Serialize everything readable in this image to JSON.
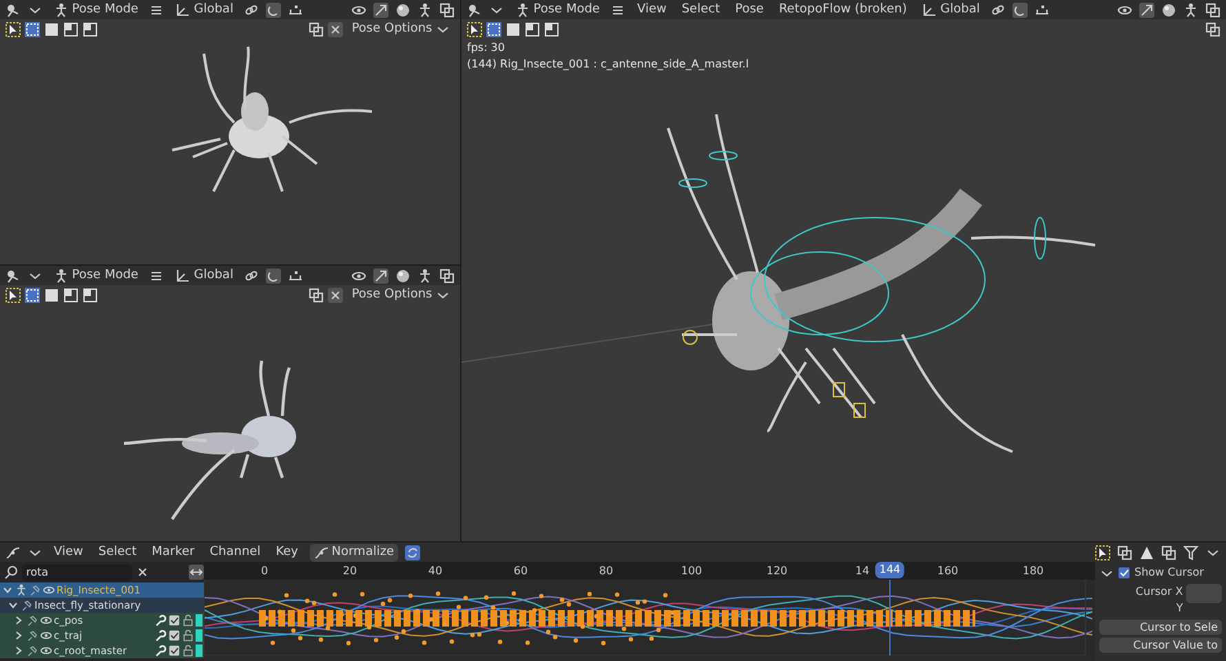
{
  "viewports": [
    {
      "header": {
        "mode": "Pose Mode",
        "orientation": "Global",
        "options": "Pose Options"
      }
    },
    {
      "header": {
        "mode": "Pose Mode",
        "orientation": "Global",
        "options": "Pose Options"
      }
    },
    {
      "header": {
        "mode": "Pose Mode",
        "menus": [
          "View",
          "Select",
          "Pose",
          "RetopoFlow (broken)"
        ],
        "orientation": "Global"
      },
      "overlay_text": [
        "fps: 30",
        "(144) Rig_Insecte_001 : c_antenne_side_A_master.l"
      ]
    }
  ],
  "graph_editor": {
    "menus": [
      "View",
      "Select",
      "Marker",
      "Channel",
      "Key"
    ],
    "normalize": {
      "label": "Normalize",
      "on": false
    },
    "search": {
      "value": "rota"
    },
    "channels": [
      {
        "kind": "object",
        "name": "Rig_Insecte_001",
        "selected": true,
        "expanded": true,
        "children": [
          {
            "kind": "action",
            "name": "Insect_fly_stationary",
            "selected": false,
            "expanded": true,
            "children": [
              {
                "kind": "group",
                "name": "c_pos",
                "selected": false,
                "expanded": false,
                "enabled": true
              },
              {
                "kind": "group",
                "name": "c_traj",
                "selected": false,
                "expanded": false,
                "enabled": true
              },
              {
                "kind": "group",
                "name": "c_root_master",
                "selected": false,
                "expanded": false,
                "enabled": true
              }
            ]
          }
        ]
      }
    ],
    "frame_ticks": [
      "0",
      "20",
      "40",
      "60",
      "80",
      "100",
      "120",
      "14",
      "160",
      "180"
    ],
    "current_frame": "144",
    "sidebar": {
      "show_cursor": {
        "label": "Show Cursor",
        "checked": true
      },
      "cursor_x_label": "Cursor X",
      "cursor_y_label": "Y",
      "buttons": [
        "Cursor to Sele",
        "Cursor Value to"
      ]
    }
  }
}
